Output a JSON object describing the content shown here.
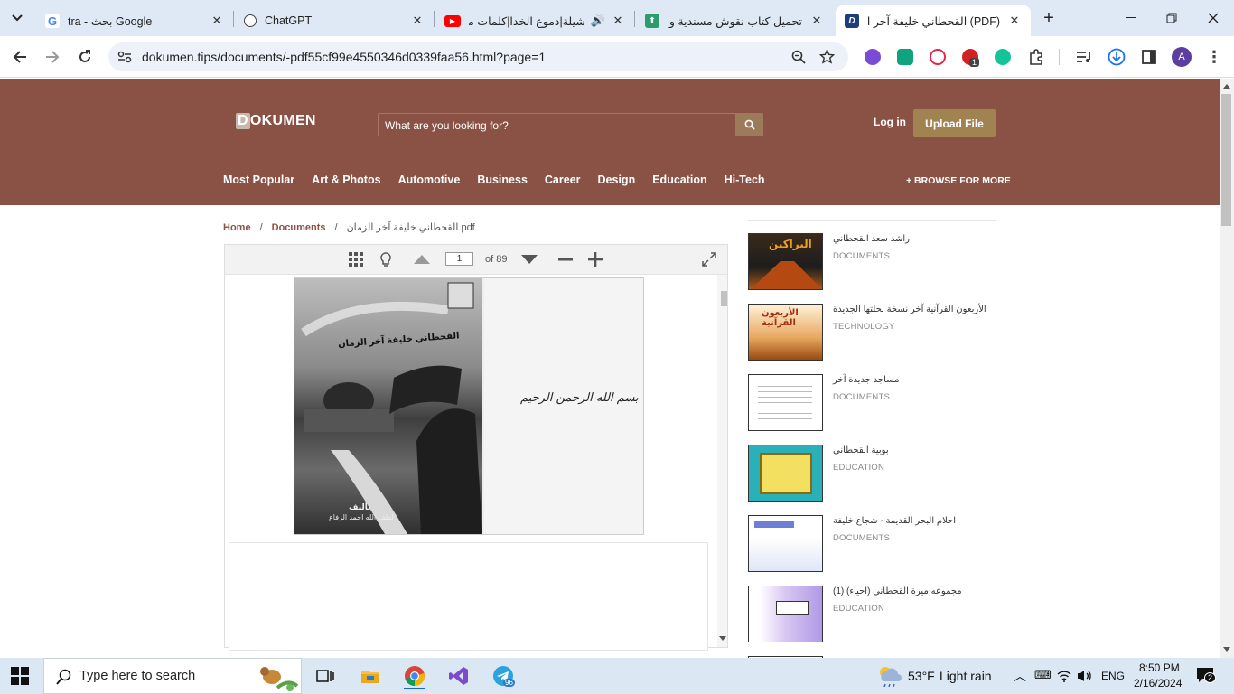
{
  "tabs": [
    {
      "title": "tra - بحث Google",
      "icon": "google-icon"
    },
    {
      "title": "ChatGPT",
      "icon": "chatgpt-icon"
    },
    {
      "title": "شيلة|دموع الخدا|كلمات مو",
      "icon": "youtube-icon"
    },
    {
      "title": "تحميل كتاب نقوش مسندية وت",
      "icon": "book-site-icon"
    },
    {
      "title": "(PDF) القحطاني خليفة آخر الزمان",
      "icon": "dokumen-icon",
      "active": true
    }
  ],
  "address": {
    "url": "dokumen.tips/documents/-pdf55cf99e4550346d0339faa56.html?page=1"
  },
  "extensions": {
    "badge": "1",
    "avatar": "A"
  },
  "site": {
    "logo": "OKUMEN",
    "logo_d": "D",
    "search_placeholder": "What are you looking for?",
    "login": "Log in",
    "upload": "Upload File",
    "categories": [
      "Most Popular",
      "Art & Photos",
      "Automotive",
      "Business",
      "Career",
      "Design",
      "Education",
      "Hi-Tech"
    ],
    "browse": "+ BROWSE FOR MORE"
  },
  "breadcrumb": {
    "home": "Home",
    "sep": "/",
    "docs": "Documents",
    "file": "القحطاني خليفة آخر الزمان.pdf"
  },
  "viewer": {
    "page_value": "1",
    "page_count": "of 89",
    "cover_title": "القحطاني خليفة آخر الزمان",
    "cover_author_label": "تأليف",
    "cover_author": "لطف الله احمد الرفاع",
    "basmala": "بسم الله الرحمن الرحيم"
  },
  "related": [
    {
      "title": "راشد سعد القحطاني",
      "category": "DOCUMENTS"
    },
    {
      "title": "الأربعون القرآنية آخر نسخة بحلتها الجديدة",
      "category": "TECHNOLOGY"
    },
    {
      "title": "مساجد جديدة آخر",
      "category": "DOCUMENTS"
    },
    {
      "title": "بوبية القحطاني",
      "category": "EDUCATION"
    },
    {
      "title": "احلام البحر القديمة - شجاع خليفة",
      "category": "DOCUMENTS"
    },
    {
      "title": "مجموعه ميرة القحطاني (احياء) (1)",
      "category": "EDUCATION"
    }
  ],
  "taskbar": {
    "search_placeholder": "Type here to search",
    "telegram_badge": "96",
    "weather_temp": "53°F",
    "weather_text": "Light rain",
    "lang": "ENG",
    "time": "8:50 PM",
    "date": "2/16/2024",
    "notif_count": "2"
  }
}
